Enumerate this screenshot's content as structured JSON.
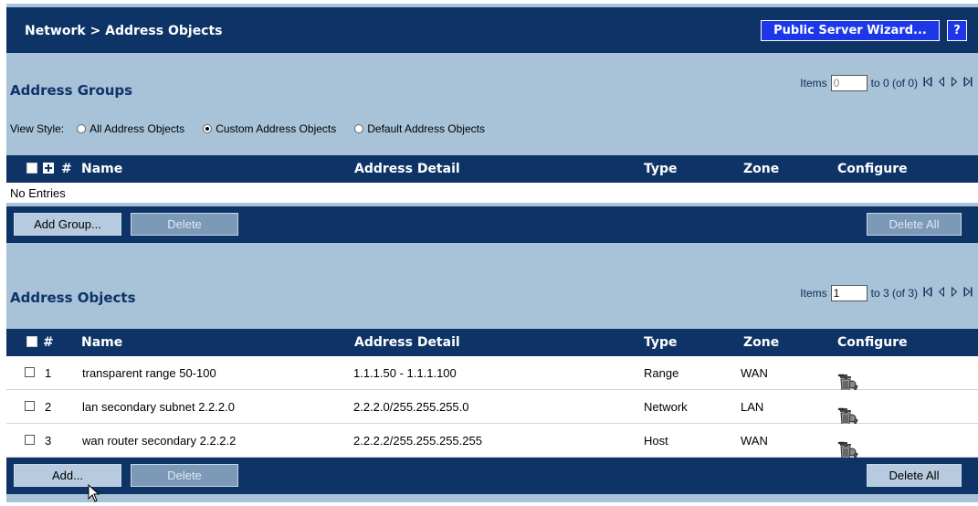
{
  "header": {
    "title": "Network > Address Objects",
    "wizard_label": "Public Server Wizard...",
    "help_label": "?"
  },
  "groups": {
    "title": "Address Groups",
    "pager": {
      "items_label": "Items",
      "start_value": "0",
      "range_text": "to 0 (of 0)"
    },
    "view_style": {
      "label": "View Style:",
      "options": [
        "All Address Objects",
        "Custom Address Objects",
        "Default Address Objects"
      ],
      "selected": "Custom Address Objects"
    },
    "columns": {
      "hash": "#",
      "name": "Name",
      "detail": "Address Detail",
      "type": "Type",
      "zone": "Zone",
      "configure": "Configure"
    },
    "empty_text": "No Entries",
    "buttons": {
      "add": "Add Group...",
      "delete": "Delete",
      "delete_all": "Delete All"
    }
  },
  "objects": {
    "title": "Address Objects",
    "pager": {
      "items_label": "Items",
      "start_value": "1",
      "range_text": "to 3 (of 3)"
    },
    "columns": {
      "hash": "#",
      "name": "Name",
      "detail": "Address Detail",
      "type": "Type",
      "zone": "Zone",
      "configure": "Configure"
    },
    "rows": [
      {
        "num": "1",
        "name": "transparent range 50-100",
        "detail": "1.1.1.50 - 1.1.1.100",
        "type": "Range",
        "zone": "WAN"
      },
      {
        "num": "2",
        "name": "lan secondary subnet 2.2.2.0",
        "detail": "2.2.2.0/255.255.255.0",
        "type": "Network",
        "zone": "LAN"
      },
      {
        "num": "3",
        "name": "wan router secondary 2.2.2.2",
        "detail": "2.2.2.2/255.255.255.255",
        "type": "Host",
        "zone": "WAN"
      }
    ],
    "buttons": {
      "add": "Add...",
      "delete": "Delete",
      "delete_all": "Delete All"
    }
  },
  "icons": {
    "first": "first-page-icon",
    "prev": "prev-page-icon",
    "next": "next-page-icon",
    "last": "last-page-icon",
    "edit": "edit-wrench-icon",
    "trash": "trash-icon"
  },
  "colors": {
    "navy": "#0d3367",
    "background": "#a8c3d8",
    "wizard_blue": "#1c37e8"
  }
}
